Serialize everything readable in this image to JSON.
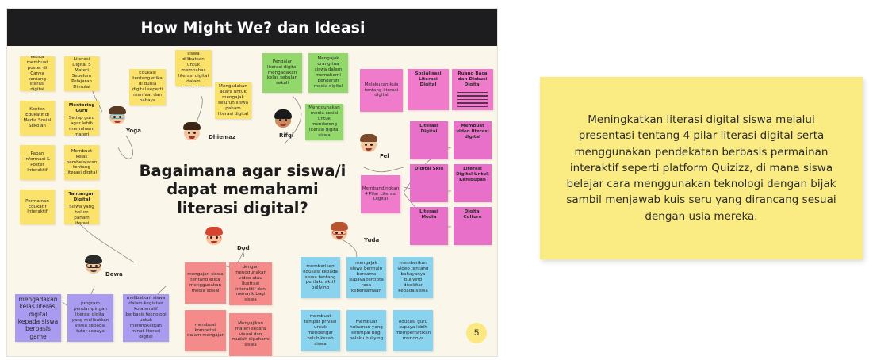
{
  "board": {
    "title": "How Might We? dan Ideasi",
    "central_question": "Bagaimana agar siswa/i dapat memahami literasi digital?",
    "page_number": "5",
    "colors": {
      "yellow": "#fbe36b",
      "green": "#92d86a",
      "pink": "#f07bcb",
      "violet": "#a99bf0",
      "salmon": "#f58a8a",
      "cyan": "#8ad3ee"
    }
  },
  "people": {
    "yoga": "Yoga",
    "dhiemaz": "Dhiemaz",
    "rifqi": "Rifqi",
    "fel": "Fel",
    "yuda": "Yuda",
    "dodi": "Dod\ni",
    "dewa": "Dewa"
  },
  "notes": {
    "y1": "ketika membuat poster di Canva tentang literasi digital",
    "y2": "Literasi Digital 5 Materi Sebelum Pelajaran Dimulai",
    "y3": "Konten Edukatif di Media Sosial Sekolah",
    "y4": "Mentoring Guru",
    "y4b": "Setiap guru agar lebih memahami materi literasi digital dalam pembelajaran",
    "y5": "Papan Informasi & Poster Interaktif",
    "y6": "Membuat kelas pembelajaran tentang literasi digital",
    "y7": "Permainan Edukatif Interaktif",
    "y8": "Tantangan Digital",
    "y8b": "Siswa yang belum paham literasi digital diberi tantangan sederhana setiap minggunya",
    "y9": "Edukasi tentang etika di dunia digital seperti manfaat dan bahaya",
    "y10": "Guru dan siswa dilibatkan untuk membahas literasi digital dalam pelajaran",
    "y11": "Mengadakan acara untuk mengajak seluruh siswa paham literasi digital",
    "g1": "Pengajar literasi digital mengadakan kelas sebulan sekali",
    "g2": "Mengajak orang tua siswa dalam memahami pengaruh media digital",
    "g3": "Menggunakan media sosial untuk mendorong literasi digital siswa",
    "p1": "Melakukan kuis tentang literasi digital",
    "p2": "Sosialisasi Literasi Digital",
    "p3": "Ruang Baca dan Diskusi Digital",
    "p4": "Literasi Digital",
    "p5": "Membuat video literasi digital",
    "p6": "Digital Skill",
    "p7": "Literasi Digital Untuk Kehidupan",
    "p8": "Literasi Media",
    "p9": "Membuat games edukasi literasi digital",
    "p10": "Membandingkan 4 Pilar Literasi Digital",
    "p11": "Digital Culture",
    "v1": "mengadakan kelas literasi digital kepada siswa berbasis game",
    "v2": "program pendampingan literasi digital yang melibatkan siswa sebagai tutor sebaya",
    "v3": "melibatkan siswa dalam kegiatan kolaboratif berbasis teknologi untuk meningkatkan minat literasi digital",
    "s1": "mengajari siswa tentang etika menggunakan media sosial",
    "s2": "dengan menggunakan video atau ilustrasi interaktif dan menarik bagi siswa",
    "s3": "membuat kompetisi dalam mengajar",
    "s4": "Menyajikan materi secara visual dan mudah dipahami siswa",
    "c1": "memberikan edukasi kepada siswa tentang perilaku aktif bullying",
    "c2": "mengajak siswa bermain bersama supaya tercipta rasa kebersamaan",
    "c3": "memberikan video tentang bahayanya bullying disekitar kepada siswa",
    "c4": "membuat tempat privasi untuk mendengar keluh kesah siswa",
    "c5": "membuat hukuman yang setimpal bagi pelaku bullying",
    "c6": "edukasi guru supaya lebih memperhatikan muridnya"
  },
  "summary": {
    "text": "Meningkatkan literasi digital siswa melalui presentasi tentang 4 pilar literasi digital serta menggunakan pendekatan berbasis permainan interaktif seperti platform Quizizz, di mana siswa belajar cara menggunakan teknologi dengan bijak sambil menjawab kuis seru  yang dirancang sesuai dengan usia mereka."
  }
}
